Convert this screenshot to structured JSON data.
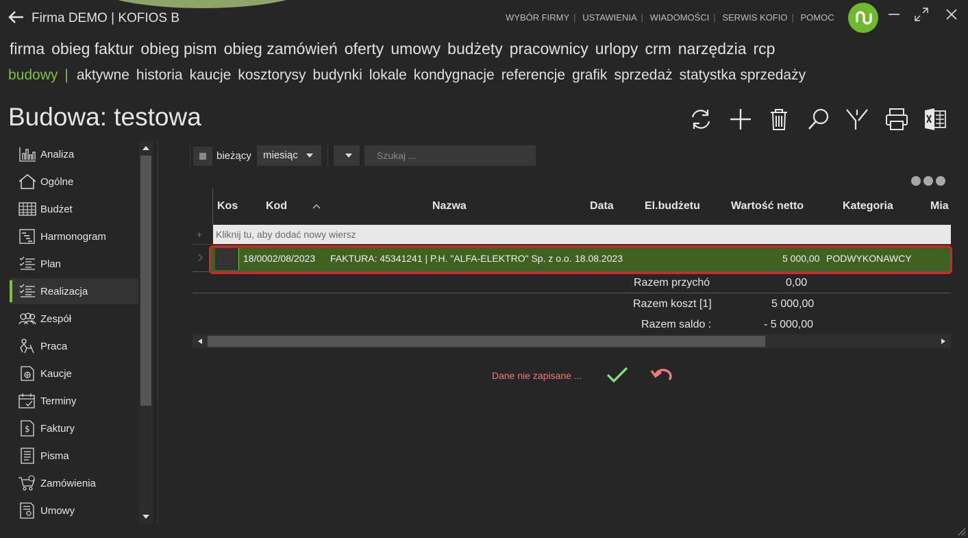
{
  "header": {
    "title": "Firma DEMO | KOFIOS B",
    "links": [
      "WYBÓR FIRMY",
      "USTAWIENIA",
      "WIADOMOŚCI",
      "SERWIS KOFIO",
      "POMOC"
    ]
  },
  "nav_main": [
    "firma",
    "obieg faktur",
    "obieg pism",
    "obieg zamówień",
    "oferty",
    "umowy",
    "budżety",
    "pracownicy",
    "urlopy",
    "crm",
    "narzędzia",
    "rcp"
  ],
  "nav_sub": {
    "active": "budowy",
    "separator": "|",
    "items": [
      "aktywne",
      "historia",
      "kaucje",
      "kosztorysy",
      "budynki",
      "lokale",
      "kondygnacje",
      "referencje",
      "grafik",
      "sprzedaż",
      "statystka sprzedaży"
    ]
  },
  "page": {
    "title": "Budowa: testowa"
  },
  "sidebar": {
    "items": [
      {
        "label": "Analiza",
        "icon": "bar-chart-icon"
      },
      {
        "label": "Ogólne",
        "icon": "home-icon"
      },
      {
        "label": "Budżet",
        "icon": "table-icon"
      },
      {
        "label": "Harmonogram",
        "icon": "gantt-icon"
      },
      {
        "label": "Plan",
        "icon": "list-check-icon"
      },
      {
        "label": "Realizacja",
        "icon": "list-check-icon"
      },
      {
        "label": "Zespół",
        "icon": "team-icon"
      },
      {
        "label": "Praca",
        "icon": "worker-icon"
      },
      {
        "label": "Kaucje",
        "icon": "deposit-icon"
      },
      {
        "label": "Terminy",
        "icon": "calendar-icon"
      },
      {
        "label": "Faktury",
        "icon": "invoice-icon"
      },
      {
        "label": "Pisma",
        "icon": "document-icon"
      },
      {
        "label": "Zamówienia",
        "icon": "cart-icon"
      },
      {
        "label": "Umowy",
        "icon": "contract-icon"
      }
    ],
    "active_index": 5
  },
  "filters": {
    "current_label": "bieżący",
    "period": "miesiąc",
    "search_placeholder": "Szukaj ..."
  },
  "grid": {
    "columns": [
      "Kos",
      "Kod",
      "Nazwa",
      "Data",
      "El.budżetu",
      "Wartość netto",
      "Kategoria",
      "Mia"
    ],
    "new_row_hint": "Kliknij tu, aby dodać nowy wiersz",
    "rows": [
      {
        "kod": "18/0002/08/2023",
        "nazwa": "FAKTURA: 45341241 | P.H. \"ALFA-ELEKTRO\" Sp. z o.o.",
        "data": "18.08.2023",
        "wartosc": "5 000,00",
        "kategoria": "PODWYKONAWCY"
      }
    ],
    "summary": [
      {
        "label": "Razem przychó",
        "value": "0,00"
      },
      {
        "label": "Razem koszt [1]",
        "value": "5 000,00"
      },
      {
        "label": "Razem saldo :",
        "value": "- 5 000,00"
      }
    ]
  },
  "status": {
    "unsaved": "Dane nie zapisane ..."
  },
  "colors": {
    "accent": "#7cc242",
    "row_bg": "#3f6221",
    "highlight": "#e31e24",
    "warning": "#f07a7a"
  }
}
